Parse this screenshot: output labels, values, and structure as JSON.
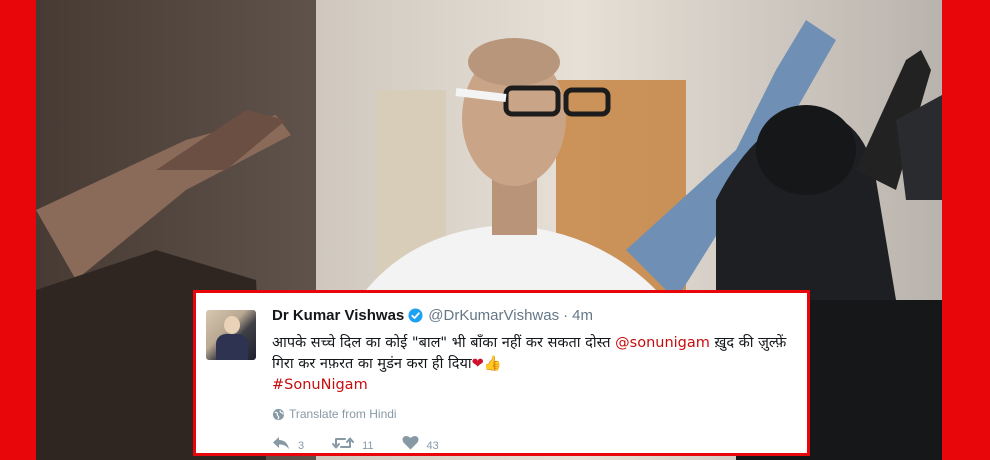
{
  "tweet": {
    "display_name": "Dr Kumar Vishwas",
    "handle": "@DrKumarVishwas",
    "separator": "·",
    "time": "4m",
    "text_part1": "आपके सच्चे दिल का कोई \"बाल\" भी बाँका नहीं कर सकता दोस्त ",
    "mention": "@sonunigam",
    "text_part2": " ख़ुद की ज़ुल्फ़ें गिरा कर नफ़रत का मुडंन करा ही दिया",
    "heart": "❤",
    "thumb": "👍",
    "hashtag": "#SonuNigam",
    "translate_label": "Translate from Hindi",
    "reply_count": "3",
    "retweet_count": "11",
    "like_count": "43"
  },
  "colors": {
    "frame": "#e8060a",
    "link": "#c60d0d",
    "verified": "#1da1f2",
    "meta": "#8899a6"
  },
  "icons": [
    "verified-badge-icon",
    "globe-icon",
    "reply-icon",
    "retweet-icon",
    "like-icon"
  ]
}
